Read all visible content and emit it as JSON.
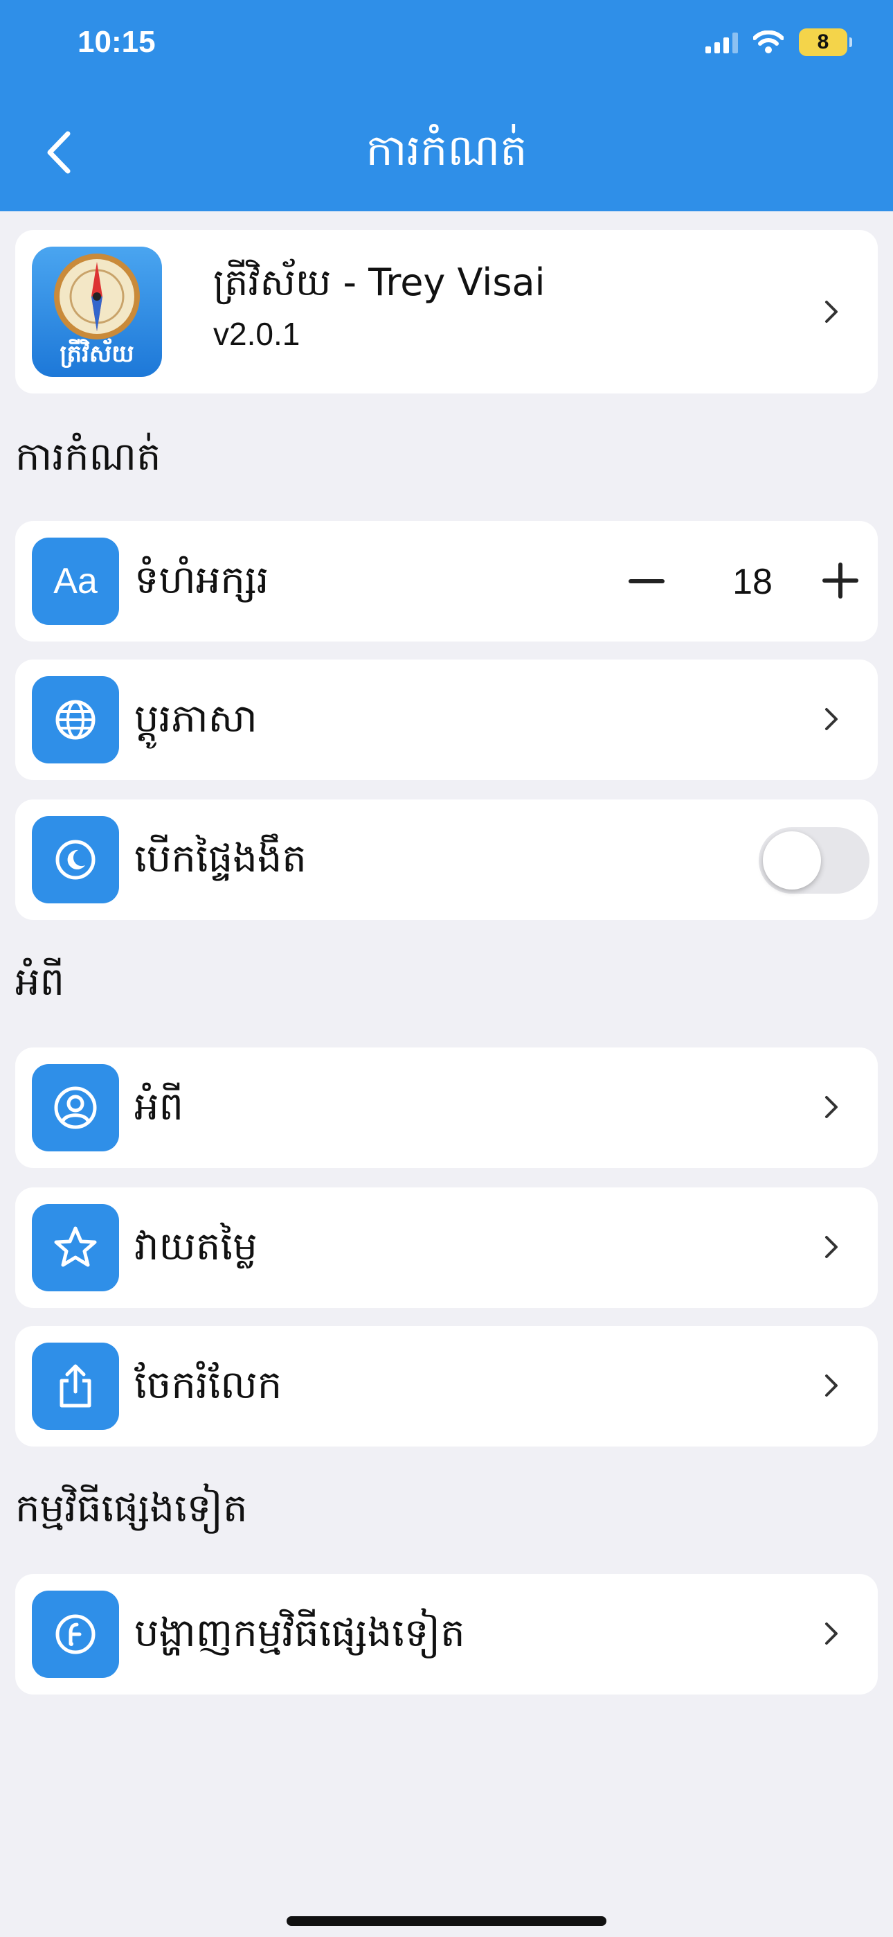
{
  "status_bar": {
    "time": "10:15",
    "battery": "8"
  },
  "header": {
    "title": "ការកំណត់"
  },
  "app_card": {
    "name": "ត្រីវិស័យ - Trey Visai",
    "version": "v2.0.1",
    "icon_text": "ត្រីវិស័យ"
  },
  "sections": {
    "settings": "ការកំណត់",
    "about": "អំពី",
    "other_apps": "កម្មវិធីផ្សេងទៀត"
  },
  "settings": {
    "font_size_label": "ទំហំអក្សរ",
    "font_size_value": "18",
    "font_size_icon_text": "Aa",
    "language_label": "ប្តូរភាសា",
    "dark_mode_label": "បើកផ្ទៃងងឹត",
    "dark_mode_on": false
  },
  "about_items": {
    "about_label": "អំពី",
    "rate_label": "វាយតម្លៃ",
    "share_label": "ចែករំលែក"
  },
  "other_apps": {
    "show_label": "បង្ហាញកម្មវិធីផ្សេងទៀត"
  },
  "colors": {
    "accent": "#2f8fe8",
    "background": "#f0f0f5",
    "card": "#ffffff"
  },
  "icons": [
    "chevron-left-icon",
    "globe-icon",
    "moon-icon",
    "user-icon",
    "star-icon",
    "share-icon",
    "store-icon",
    "chevron-right-icon"
  ]
}
